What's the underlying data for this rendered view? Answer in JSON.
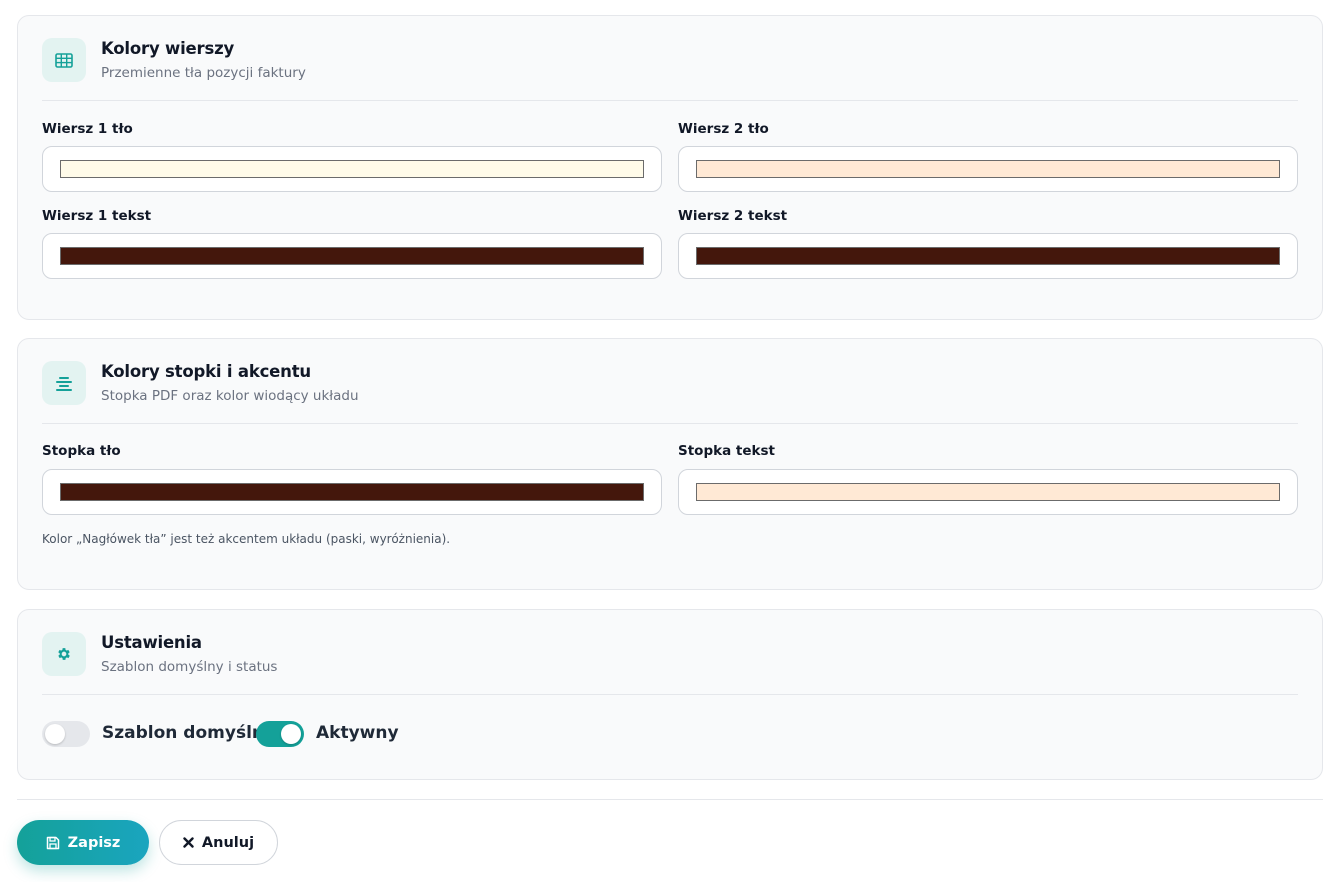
{
  "row_colors": {
    "title": "Kolory wierszy",
    "subtitle": "Przemienne tła pozycji faktury",
    "icon": "table-icon",
    "fields": [
      {
        "label": "Wiersz 1 tło",
        "color": "#fffbe9"
      },
      {
        "label": "Wiersz 2 tło",
        "color": "#ffe9d5"
      },
      {
        "label": "Wiersz 1 tekst",
        "color": "#44170c"
      },
      {
        "label": "Wiersz 2 tekst",
        "color": "#44170c"
      }
    ]
  },
  "footer_colors": {
    "title": "Kolory stopki i akcentu",
    "subtitle": "Stopka PDF oraz kolor wiodący układu",
    "icon": "align-center-icon",
    "fields": [
      {
        "label": "Stopka tło",
        "color": "#44170c"
      },
      {
        "label": "Stopka tekst",
        "color": "#ffe9d5"
      }
    ],
    "hint": "Kolor „Nagłówek tła” jest też akcentem układu (paski, wyróżnienia)."
  },
  "settings": {
    "title": "Ustawienia",
    "subtitle": "Szablon domyślny i status",
    "icon": "gear-icon",
    "toggles": [
      {
        "label": "Szablon domyślny",
        "on": false
      },
      {
        "label": "Aktywny",
        "on": true
      }
    ]
  },
  "actions": {
    "save_label": "Zapisz",
    "save_icon": "floppy-disk-icon",
    "cancel_label": "Anuluj",
    "cancel_icon": "close-icon"
  },
  "colors": {
    "accent": "#14a199",
    "toggle_off": "#e5e7eb"
  }
}
